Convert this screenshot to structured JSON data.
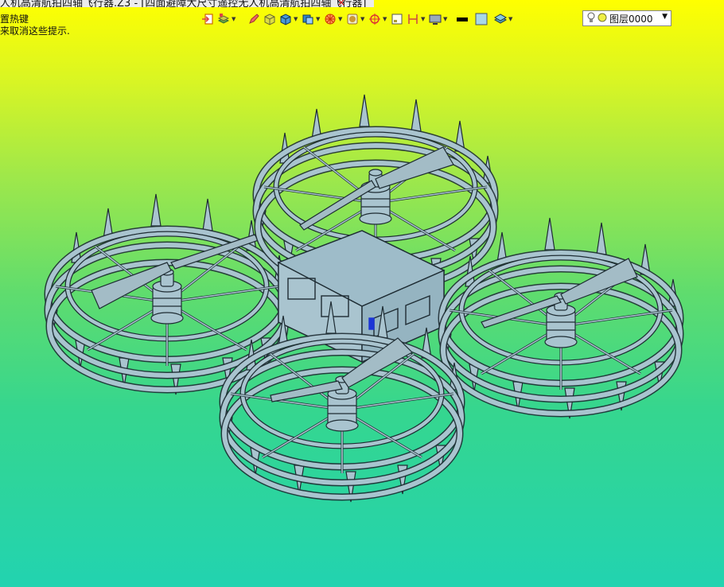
{
  "window": {
    "tab_title": "人机高清航拍四轴飞行器.Z3 - [四面避障大尺寸遥控无人机高清航拍四轴飞行器]",
    "tab_close": "×"
  },
  "hints": {
    "line1": "置热键",
    "line2": "来取消这些提示."
  },
  "toolbar": {
    "buttons": [
      {
        "icon": "exit-icon",
        "color": "#d44"
      },
      {
        "icon": "layers-tool-icon",
        "color": "#6a4"
      },
      {
        "icon": "pencil-icon",
        "color": "#c33"
      },
      {
        "icon": "box-icon",
        "color": "#cc4"
      },
      {
        "icon": "cube-icon",
        "color": "#38c"
      },
      {
        "icon": "shaded-cube-icon",
        "color": "#38c"
      },
      {
        "icon": "render-icon",
        "color": "#d40"
      },
      {
        "icon": "texture-icon",
        "color": "#c93"
      },
      {
        "icon": "target-icon",
        "color": "#d33"
      },
      {
        "icon": "frame-icon",
        "color": "#a93"
      },
      {
        "icon": "dimension-icon",
        "color": "#c44"
      },
      {
        "icon": "screen-icon",
        "color": "#557"
      },
      {
        "icon": "color-swatch-icon",
        "color": "#000"
      },
      {
        "icon": "fill-swatch-icon",
        "color": "#a8d8e8"
      },
      {
        "icon": "stack-icon",
        "color": "#5ab"
      }
    ],
    "layer": {
      "value": "图层0000",
      "bulb_icon": "lightbulb-icon",
      "dot_icon": "layer-color-icon",
      "dropdown_icon": "chevron-down-icon"
    }
  },
  "viewport": {
    "model_fill": "#a9c4cf",
    "model_stroke": "#1e2c33",
    "body_top": "#9ebcc9",
    "blade_fill": "#a3bcc6"
  }
}
